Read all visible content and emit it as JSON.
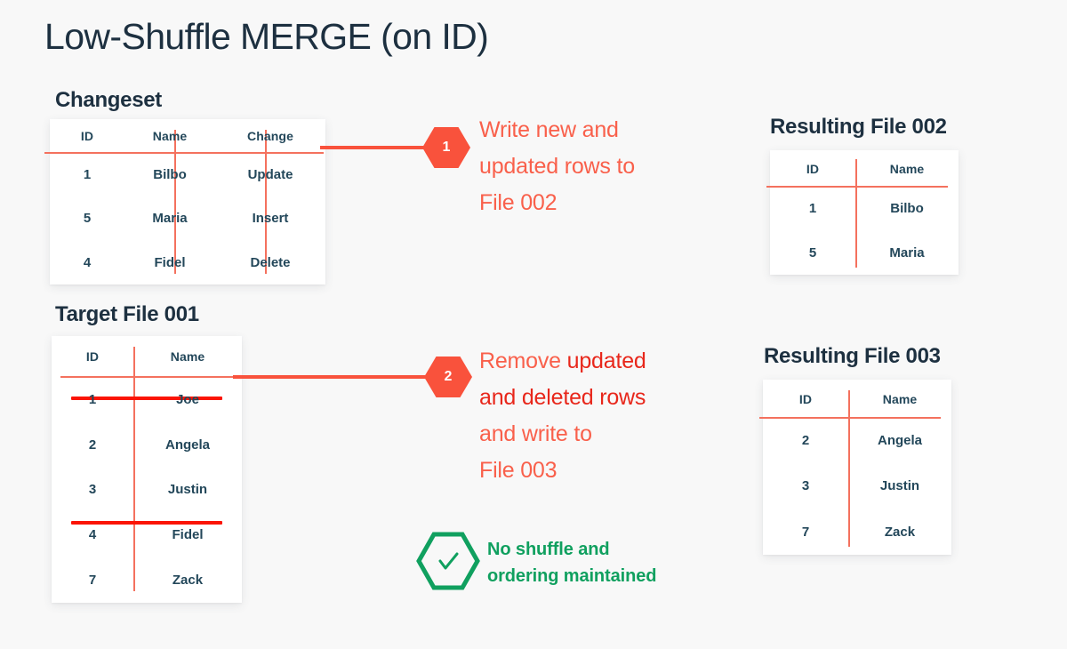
{
  "page": {
    "title": "Low-Shuffle MERGE (on ID)",
    "background_color": "#f8f8f8",
    "accent_orange": "#f9523c",
    "rule_color": "#f4715e",
    "strike_color": "#fb1405",
    "text_dark": "#1d3040",
    "cell_text": "#23475a",
    "green": "#10a05f"
  },
  "changeset": {
    "title": "Changeset",
    "columns": [
      "ID",
      "Name",
      "Change"
    ],
    "rows": [
      {
        "id": "1",
        "name": "Bilbo",
        "change": "Update"
      },
      {
        "id": "5",
        "name": "Maria",
        "change": "Insert"
      },
      {
        "id": "4",
        "name": "Fidel",
        "change": "Delete"
      }
    ]
  },
  "target_file": {
    "title": "Target File 001",
    "columns": [
      "ID",
      "Name"
    ],
    "rows": [
      {
        "id": "1",
        "name": "Joe",
        "struck": true
      },
      {
        "id": "2",
        "name": "Angela",
        "struck": false
      },
      {
        "id": "3",
        "name": "Justin",
        "struck": false
      },
      {
        "id": "4",
        "name": "Fidel",
        "struck": true
      },
      {
        "id": "7",
        "name": "Zack",
        "struck": false
      }
    ]
  },
  "result_002": {
    "title": "Resulting File 002",
    "columns": [
      "ID",
      "Name"
    ],
    "rows": [
      {
        "id": "1",
        "name": "Bilbo"
      },
      {
        "id": "5",
        "name": "Maria"
      }
    ]
  },
  "result_003": {
    "title": "Resulting File 003",
    "columns": [
      "ID",
      "Name"
    ],
    "rows": [
      {
        "id": "2",
        "name": "Angela"
      },
      {
        "id": "3",
        "name": "Justin"
      },
      {
        "id": "7",
        "name": "Zack"
      }
    ]
  },
  "steps": [
    {
      "number": "1",
      "line1": "Write new and",
      "line2": "updated rows to",
      "line3": "File 002"
    },
    {
      "number": "2",
      "line1_a": "Remove ",
      "line1_b": "updated",
      "line2_b": "and deleted rows",
      "line3": "and write to",
      "line4": "File 003"
    }
  ],
  "note": {
    "icon": "check-icon",
    "line1": "No shuffle and",
    "line2": "ordering maintained"
  }
}
